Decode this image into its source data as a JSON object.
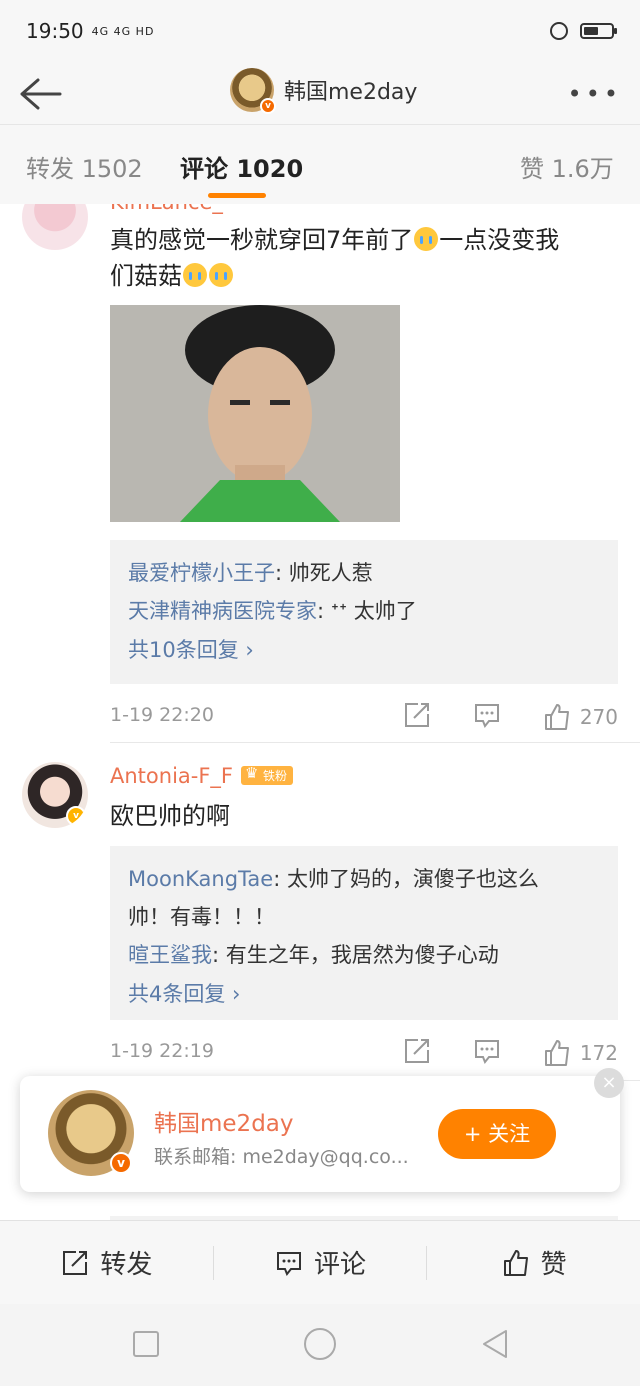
{
  "status_bar": {
    "time": "19:50",
    "signal_text": "4G 4G HD"
  },
  "nav": {
    "title": "韩国me2day"
  },
  "tabs": [
    {
      "label": "转发 1502"
    },
    {
      "label": "评论 1020"
    },
    {
      "label": "赞 1.6万"
    }
  ],
  "comments": [
    {
      "user": "KimLance_",
      "text_line1": "真的感觉一秒就穿回7年前了",
      "text_line1b": "一点没变我",
      "text_line2": "们菇菇",
      "replies": [
        {
          "user": "最爱柠檬小王子",
          "text": ": 帅死人惹"
        },
        {
          "user": "天津精神病医院专家",
          "text": ": ᐩᐩ 太帅了"
        }
      ],
      "more": "共10条回复 ›",
      "time": "1-19 22:20",
      "likes": "270"
    },
    {
      "user": "Antonia-F_F",
      "badge": "铁粉",
      "text": "欧巴帅的啊",
      "replies": [
        {
          "user": "MoonKangTae",
          "text": ": 太帅了妈的，演傻子也这么",
          "text2": "帅！有毒！！！"
        },
        {
          "user": "暄王鲨我",
          "text": ": 有生之年，我居然为傻子心动"
        }
      ],
      "more": "共4条回复 ›",
      "time": "1-19 22:19",
      "likes": "172"
    }
  ],
  "popup": {
    "name": "韩国me2day",
    "email": "联系邮箱: me2day@qq.co...",
    "follow": "+ 关注",
    "close": "×"
  },
  "bottom_bar": {
    "repost": "转发",
    "comment": "评论",
    "like": "赞"
  }
}
